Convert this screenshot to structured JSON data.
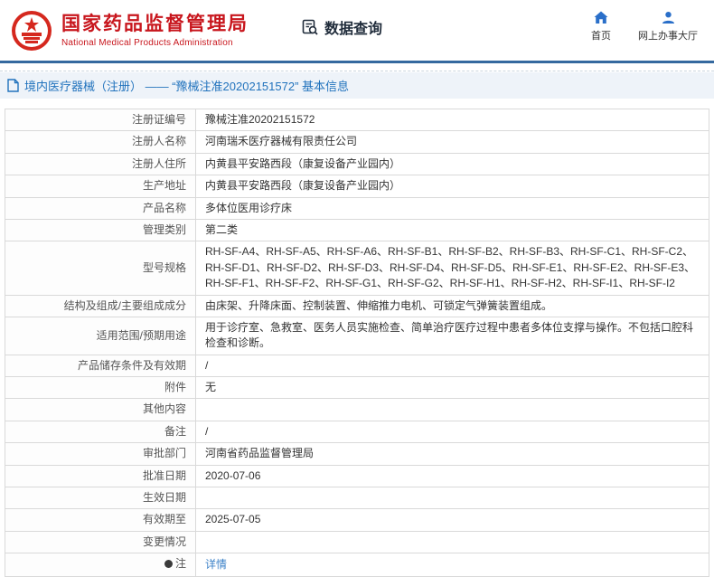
{
  "header": {
    "agency_cn": "国家药品监督管理局",
    "agency_en": "National Medical Products Administration",
    "section": "数据查询",
    "nav_home": "首页",
    "nav_hall": "网上办事大厅"
  },
  "breadcrumb": "境内医疗器械（注册） —— “豫械注准20202151572” 基本信息",
  "rows": [
    {
      "label": "注册证编号",
      "value": "豫械注准20202151572"
    },
    {
      "label": "注册人名称",
      "value": "河南瑞禾医疗器械有限责任公司"
    },
    {
      "label": "注册人住所",
      "value": "内黄县平安路西段（康复设备产业园内）"
    },
    {
      "label": "生产地址",
      "value": "内黄县平安路西段（康复设备产业园内）"
    },
    {
      "label": "产品名称",
      "value": "多体位医用诊疗床"
    },
    {
      "label": "管理类别",
      "value": "第二类"
    },
    {
      "label": "型号规格",
      "value": "RH-SF-A4、RH-SF-A5、RH-SF-A6、RH-SF-B1、RH-SF-B2、RH-SF-B3、RH-SF-C1、RH-SF-C2、RH-SF-D1、RH-SF-D2、RH-SF-D3、RH-SF-D4、RH-SF-D5、RH-SF-E1、RH-SF-E2、RH-SF-E3、RH-SF-F1、RH-SF-F2、RH-SF-G1、RH-SF-G2、RH-SF-H1、RH-SF-H2、RH-SF-I1、RH-SF-I2"
    },
    {
      "label": "结构及组成/主要组成成分",
      "value": "由床架、升降床面、控制装置、伸缩推力电机、可锁定气弹簧装置组成。"
    },
    {
      "label": "适用范围/预期用途",
      "value": "用于诊疗室、急救室、医务人员实施检查、简单治疗医疗过程中患者多体位支撑与操作。不包括口腔科检查和诊断。"
    },
    {
      "label": "产品储存条件及有效期",
      "value": "/"
    },
    {
      "label": "附件",
      "value": "无"
    },
    {
      "label": "其他内容",
      "value": ""
    },
    {
      "label": "备注",
      "value": "/"
    },
    {
      "label": "审批部门",
      "value": "河南省药品监督管理局"
    },
    {
      "label": "批准日期",
      "value": "2020-07-06"
    },
    {
      "label": "生效日期",
      "value": ""
    },
    {
      "label": "有效期至",
      "value": "2025-07-05"
    },
    {
      "label": "变更情况",
      "value": ""
    },
    {
      "label": "注",
      "value": "详情"
    }
  ],
  "colors": {
    "brand_red": "#c8161d",
    "accent_blue": "#35699f",
    "link_blue": "#3c82c8",
    "breadcrumb_bg": "#eef3f9"
  },
  "icons": {
    "logo": "national-emblem",
    "section": "data-query-icon",
    "home": "home-icon",
    "hall": "user-icon",
    "breadcrumb": "document-icon",
    "note": "note-icon"
  }
}
